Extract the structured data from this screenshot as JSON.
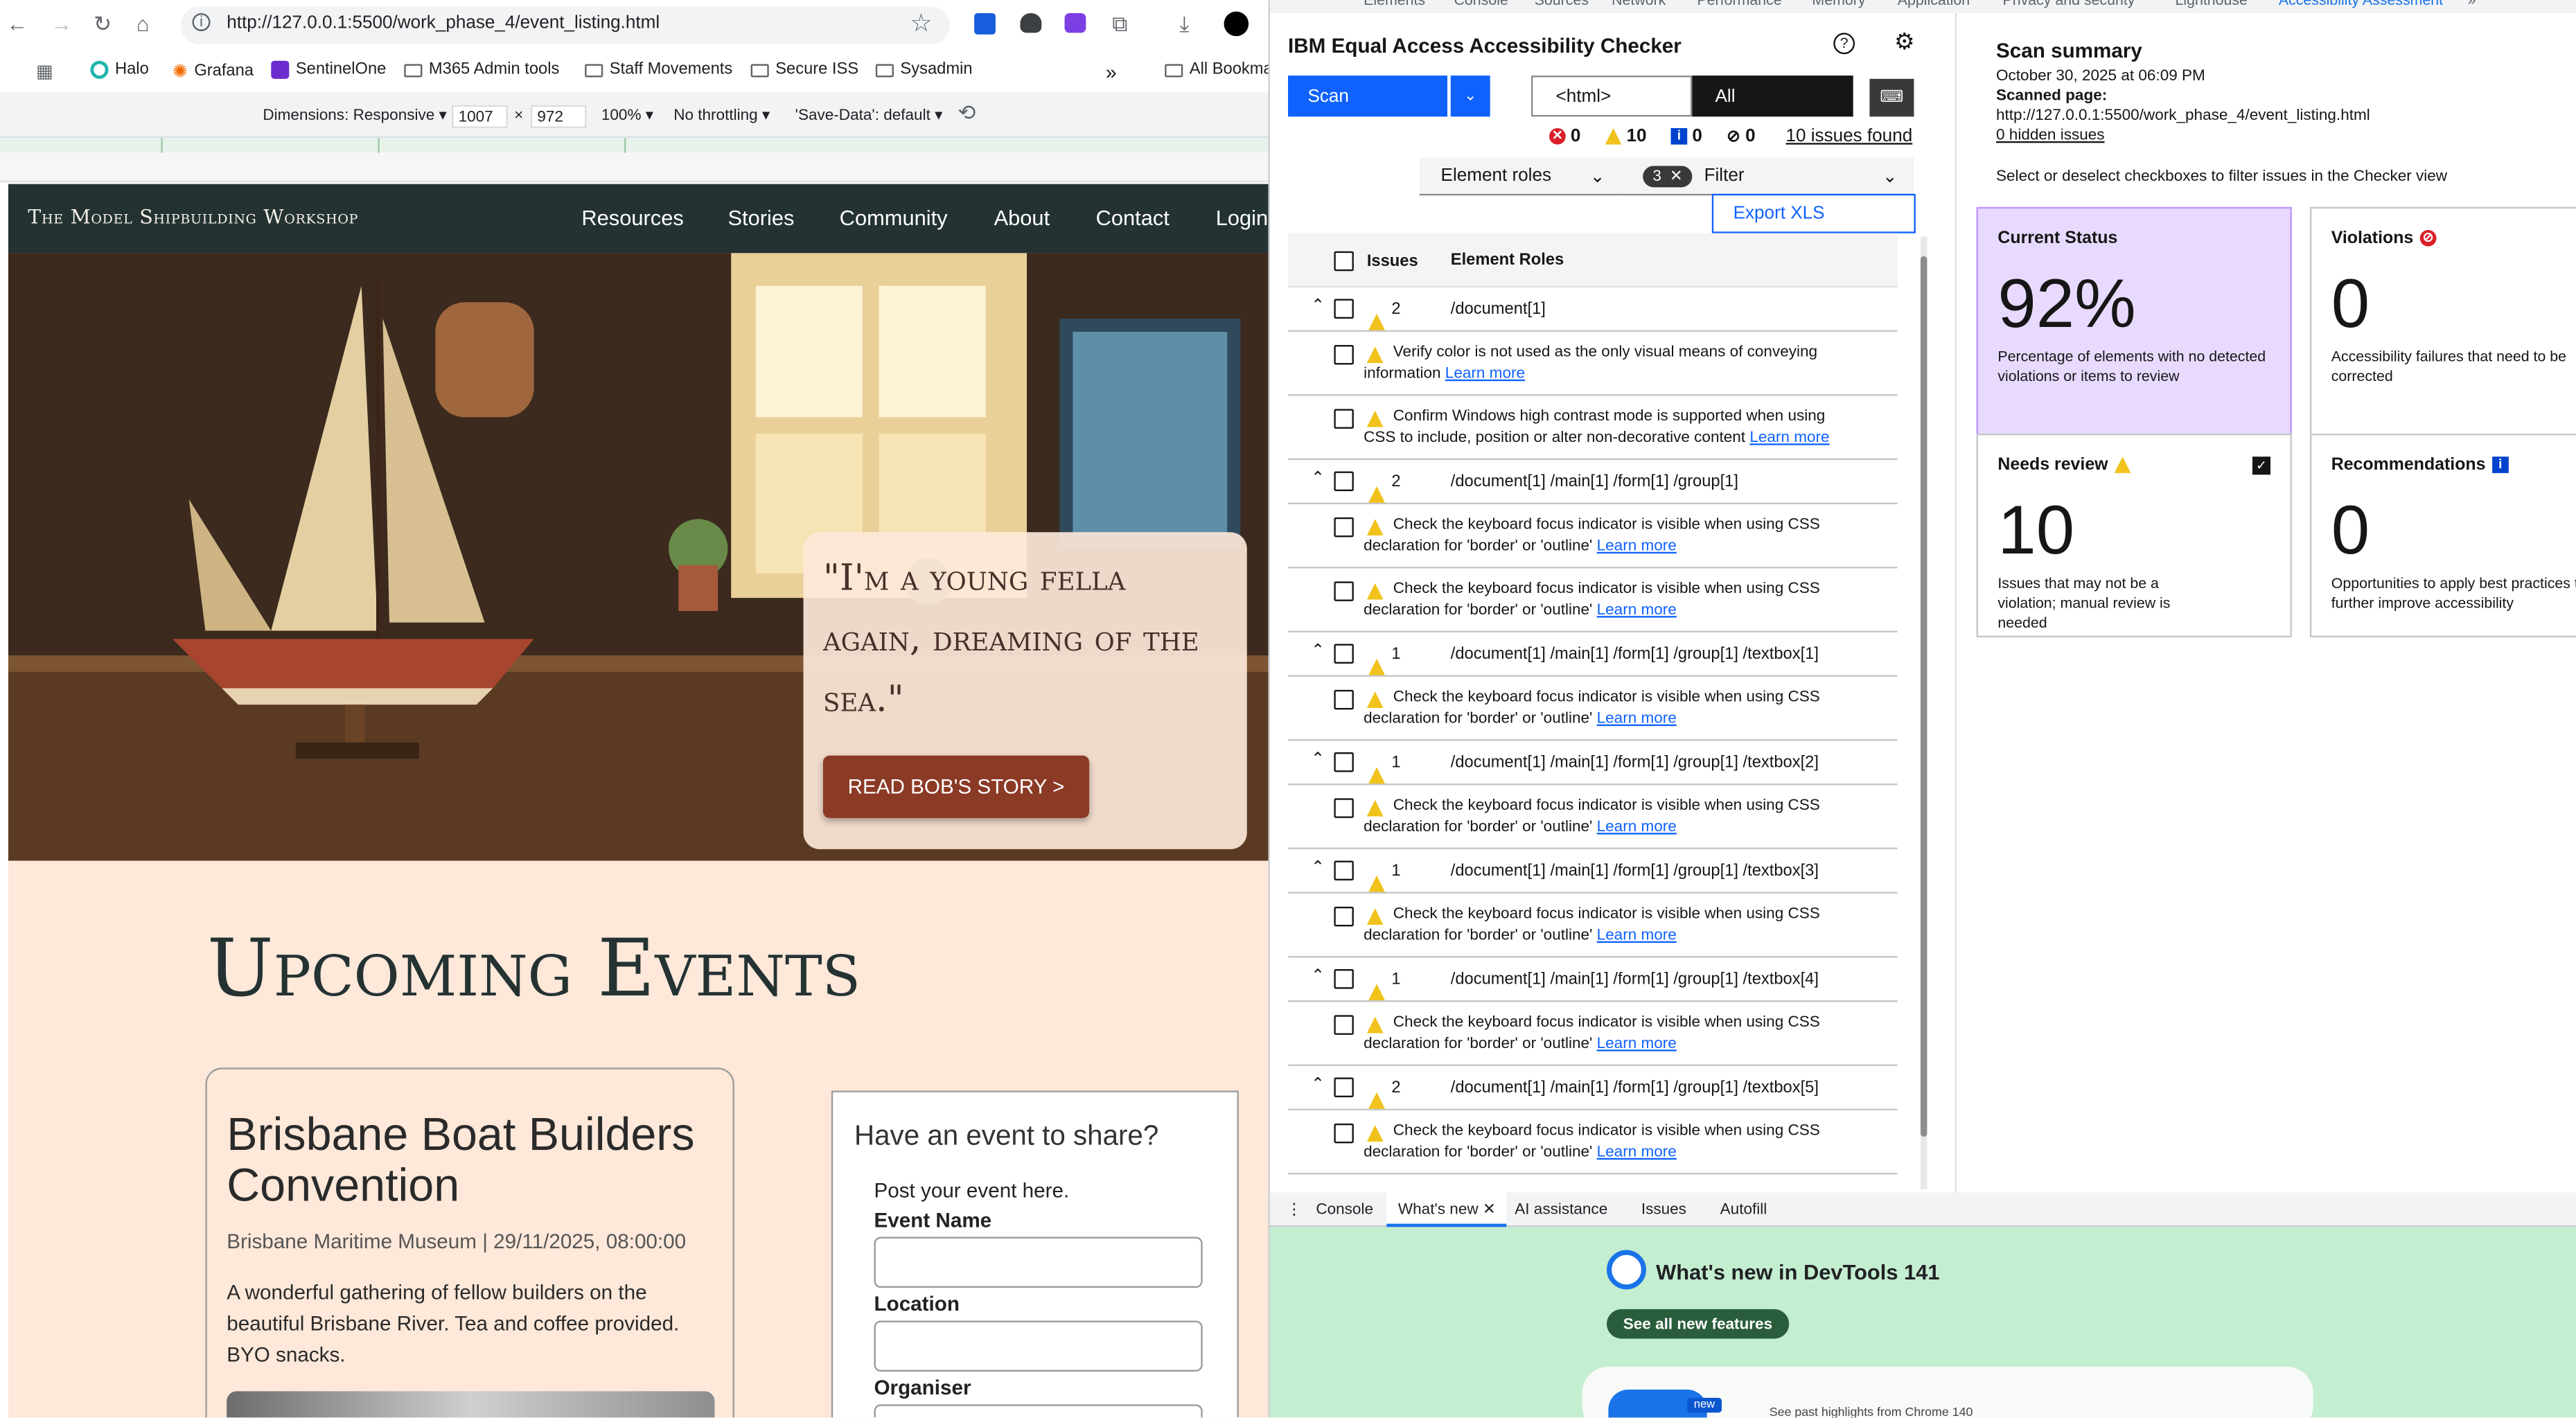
{
  "browser": {
    "url": "http://127.0.0.1:5500/work_phase_4/event_listing.html",
    "bookmarks": [
      "Halo",
      "Grafana",
      "SentinelOne",
      "M365 Admin tools",
      "Staff Movements",
      "Secure ISS",
      "Sysadmin",
      "All Bookma"
    ],
    "bookmarks_more": "»",
    "device_toolbar": {
      "dimensions_label": "Dimensions: Responsive ▾",
      "width": "1007",
      "times": "×",
      "height": "972",
      "zoom": "100% ▾",
      "throttling": "No throttling ▾",
      "save_data": "'Save-Data': default ▾"
    }
  },
  "site": {
    "brand": "The Model Shipbuilding Workshop",
    "nav": [
      "Resources",
      "Stories",
      "Community",
      "About",
      "Contact",
      "Login"
    ],
    "hero_quote": "\"I'm a young fella again, dreaming of the sea.\"",
    "hero_button": "READ BOB'S STORY >",
    "events_title": "Upcoming Events",
    "event": {
      "title": "Brisbane Boat Builders Convention",
      "meta": "Brisbane Maritime Museum | 29/11/2025, 08:00:00",
      "desc": "A wonderful gathering of fellow builders on the beautiful Brisbane River. Tea and coffee provided. BYO snacks."
    },
    "form": {
      "title": "Have an event to share?",
      "subtitle": "Post your event here.",
      "labels": [
        "Event Name",
        "Location",
        "Organiser"
      ]
    }
  },
  "devtools": {
    "tabs": [
      "Elements",
      "Console",
      "Sources",
      "Network",
      "Performance",
      "Memory",
      "Application",
      "Privacy and security",
      "Lighthouse",
      "Accessibility Assessment"
    ],
    "tabs_more": "»",
    "drawer_tabs": [
      "Console",
      "What's new",
      "AI assistance",
      "Issues",
      "Autofill"
    ],
    "whats_new_title": "What's new in DevTools 141",
    "see_all": "See all new features",
    "card_badge": "new",
    "card_text": "See past highlights from Chrome 140"
  },
  "checker": {
    "title": "IBM Equal Access Accessibility Checker",
    "scan_label": "Scan",
    "scope_value": "<html>",
    "filter_value": "All",
    "counts": {
      "violations": "0",
      "needs_review": "10",
      "recommendations": "0",
      "hidden": "0"
    },
    "issues_found": "10 issues found",
    "element_roles_label": "Element roles",
    "filter_pill": "3",
    "filter_label": "Filter",
    "export_label": "Export XLS",
    "col_issues": "Issues",
    "col_roles": "Element Roles",
    "learn_more": "Learn more",
    "rows": [
      {
        "type": "group",
        "count": "2",
        "path": "/document[1]"
      },
      {
        "type": "item",
        "text": "Verify color is not used as the only visual means of conveying information"
      },
      {
        "type": "item",
        "text": "Confirm Windows high contrast mode is supported when using CSS to include, position or alter non-decorative content"
      },
      {
        "type": "group",
        "count": "2",
        "path": "/document[1] /main[1] /form[1] /group[1]"
      },
      {
        "type": "item",
        "text": "Check the keyboard focus indicator is visible when using CSS declaration for 'border' or 'outline'"
      },
      {
        "type": "item",
        "text": "Check the keyboard focus indicator is visible when using CSS declaration for 'border' or 'outline'"
      },
      {
        "type": "group",
        "count": "1",
        "path": "/document[1] /main[1] /form[1] /group[1] /textbox[1]"
      },
      {
        "type": "item",
        "text": "Check the keyboard focus indicator is visible when using CSS declaration for 'border' or 'outline'"
      },
      {
        "type": "group",
        "count": "1",
        "path": "/document[1] /main[1] /form[1] /group[1] /textbox[2]"
      },
      {
        "type": "item",
        "text": "Check the keyboard focus indicator is visible when using CSS declaration for 'border' or 'outline'"
      },
      {
        "type": "group",
        "count": "1",
        "path": "/document[1] /main[1] /form[1] /group[1] /textbox[3]"
      },
      {
        "type": "item",
        "text": "Check the keyboard focus indicator is visible when using CSS declaration for 'border' or 'outline'"
      },
      {
        "type": "group",
        "count": "1",
        "path": "/document[1] /main[1] /form[1] /group[1] /textbox[4]"
      },
      {
        "type": "item",
        "text": "Check the keyboard focus indicator is visible when using CSS declaration for 'border' or 'outline'"
      },
      {
        "type": "group",
        "count": "2",
        "path": "/document[1] /main[1] /form[1] /group[1] /textbox[5]"
      },
      {
        "type": "item",
        "text": "Check the keyboard focus indicator is visible when using CSS declaration for 'border' or 'outline'"
      }
    ]
  },
  "summary": {
    "title": "Scan summary",
    "date": "October 30, 2025 at 06:09 PM",
    "scanned_label": "Scanned page:",
    "scanned_url": "http://127.0.0.1:5500/work_phase_4/event_listing.html",
    "hidden": "0 hidden issues",
    "instructions": "Select or deselect checkboxes to filter issues in the Checker view",
    "tiles": [
      {
        "title": "Current Status",
        "value": "92%",
        "desc": "Percentage of elements with no detected violations or items to review"
      },
      {
        "title": "Violations",
        "value": "0",
        "desc": "Accessibility failures that need to be corrected"
      },
      {
        "title": "Needs review",
        "value": "10",
        "desc": "Issues that may not be a violation; manual review is needed"
      },
      {
        "title": "Recommendations",
        "value": "0",
        "desc": "Opportunities to apply best practices to further improve accessibility"
      }
    ]
  },
  "colors": {
    "accent": "#0f62fe",
    "violation": "#da1e28",
    "warning": "#f1c21b",
    "status_tile": "#e8daff",
    "site_nav": "#243232",
    "site_bg": "#fde8d9",
    "hero_button": "#8b3a26"
  }
}
